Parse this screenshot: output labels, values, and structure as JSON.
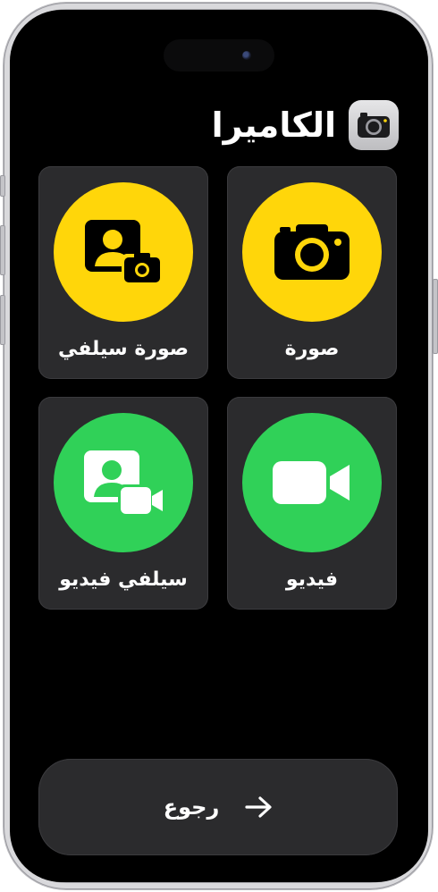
{
  "header": {
    "title": "الكاميرا",
    "icon": "camera-icon"
  },
  "tiles": [
    {
      "label": "صورة",
      "icon": "camera-icon",
      "color": "#ffd60a"
    },
    {
      "label": "صورة سيلفي",
      "icon": "selfie-photo-icon",
      "color": "#ffd60a"
    },
    {
      "label": "فيديو",
      "icon": "video-camera-icon",
      "color": "#30d158"
    },
    {
      "label": "سيلفي فيديو",
      "icon": "selfie-video-icon",
      "color": "#30d158"
    }
  ],
  "back": {
    "label": "رجوع",
    "icon": "arrow-right-icon"
  }
}
